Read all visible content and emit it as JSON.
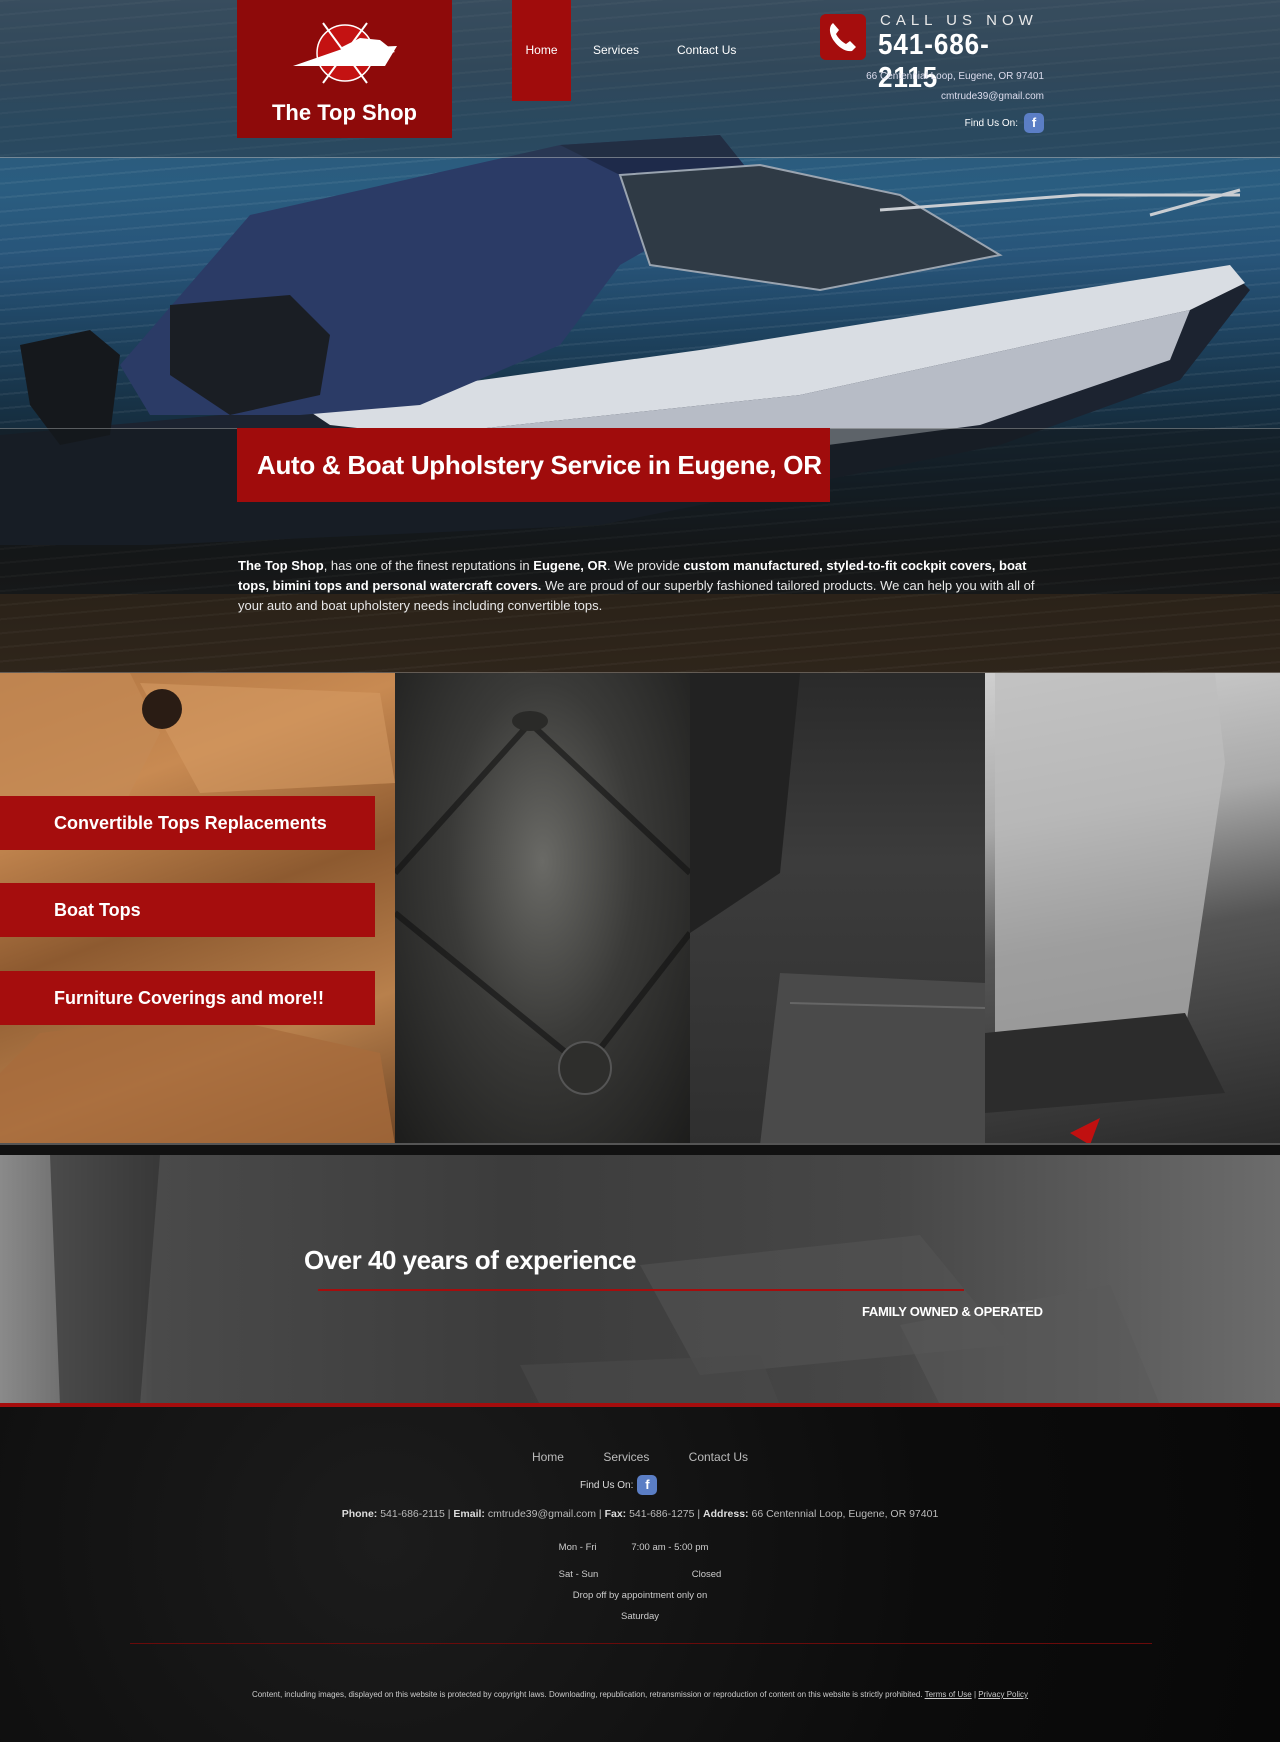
{
  "brand": {
    "name": "The Top Shop"
  },
  "nav": {
    "items": [
      "Home",
      "Services",
      "Contact Us"
    ],
    "active": "Home"
  },
  "contact_header": {
    "call_label": "CALL US NOW",
    "phone": "541-686-2115",
    "address": "66 Centennial Loop, Eugene, OR 97401",
    "email": "cmtrude39@gmail.com",
    "find_us": "Find Us On:",
    "facebook_glyph": "f"
  },
  "hero": {
    "headline": "Auto & Boat Upholstery Service in Eugene, OR",
    "intro": {
      "p1": "The Top Shop",
      "p2": ", has one of the finest reputations in ",
      "p3": "Eugene, OR",
      "p4": ". We provide ",
      "p5": "custom manufactured, styled-to-fit cockpit covers, boat tops, bimini tops and personal watercraft covers.",
      "p6": " We are proud of our superbly fashioned tailored products. We can help you with all of your auto and boat upholstery needs including convertible tops."
    }
  },
  "services": [
    "Convertible Tops Replacements",
    "Boat Tops",
    "Furniture Coverings and more!!"
  ],
  "experience": {
    "title": "Over 40 years of experience",
    "subtitle": "FAMILY OWNED & OPERATED"
  },
  "footer": {
    "nav": [
      "Home",
      "Services",
      "Contact Us"
    ],
    "find_us": "Find Us On:",
    "facebook_glyph": "f",
    "phone_label": "Phone:",
    "phone": "541-686-2115",
    "email_label": "Email:",
    "email": "cmtrude39@gmail.com",
    "fax_label": "Fax:",
    "fax": "541-686-1275",
    "address_label": "Address:",
    "address": "66 Centennial Loop, Eugene, OR 97401",
    "sep": "|",
    "hours": {
      "weekday_label": "Mon - Fri",
      "weekday_hours": "7:00 am - 5:00 pm",
      "weekend_label": "Sat - Sun",
      "weekend_hours": "Closed",
      "note_line1": "Drop off by appointment only on",
      "note_line2": "Saturday"
    },
    "copyright": "Content, including images, displayed on this website is protected by copyright laws. Downloading, republication, retransmission or reproduction of content on this website is strictly prohibited.",
    "terms": "Terms of Use",
    "privacy": "Privacy Policy"
  },
  "colors": {
    "brand_red": "#a00c0c",
    "facebook": "#5b7ec5"
  }
}
